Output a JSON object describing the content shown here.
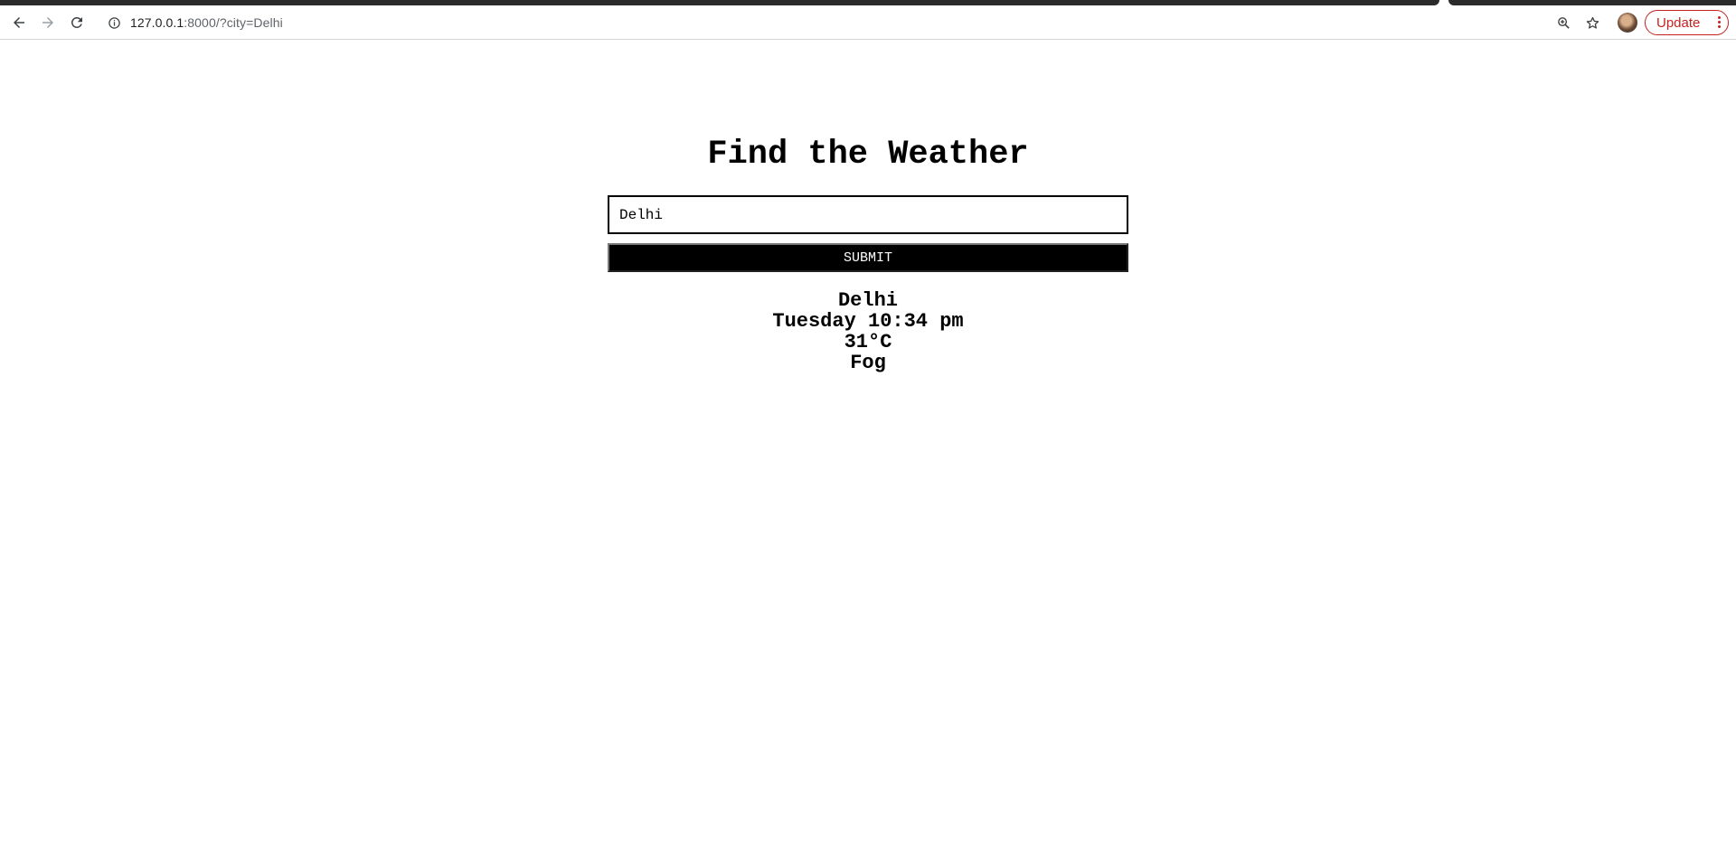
{
  "browser": {
    "url_host": "127.0.0.1",
    "url_rest": ":8000/?city=Delhi",
    "update_label": "Update",
    "icons": {
      "back": "back-arrow-icon",
      "forward": "forward-arrow-icon",
      "reload": "reload-icon",
      "info": "site-info-icon",
      "zoom": "zoom-icon",
      "bookmark": "star-icon",
      "menu": "kebab-menu-icon"
    },
    "accent_color": "#c5221f"
  },
  "app": {
    "title": "Find the Weather",
    "city_input_value": "Delhi",
    "submit_label": "SUBMIT"
  },
  "weather": {
    "city": "Delhi",
    "datetime": "Tuesday 10:34 pm",
    "temperature": "31°C",
    "description": "Fog"
  }
}
